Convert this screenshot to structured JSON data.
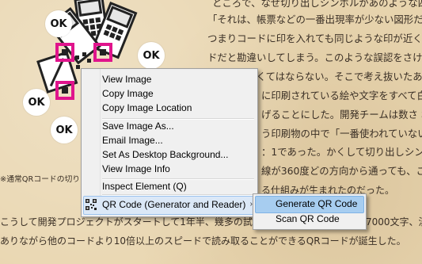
{
  "article": {
    "lines": [
      "ところで、なぜ切り出しシンボルがあのような四角",
      "「それは、帳票などの一番出現率が少ない図形だっ",
      "つまりコードに印を入れても同じような印が近くに",
      "ドだと勘違いしてしまう。このような誤認をさける",
      "の辺りとなくてはならない。そこで考え抜いたあげ",
      "に印刷されている絵や文字をすべて白黒",
      "げることにした。開発チームは数さ れ",
      "う印刷物の中で「一番使われていない比",
      "：1であった。かくして切り出しシンボ",
      "線が360度どの方向から通っても、この",
      "る仕組みが生まれたのだった。"
    ],
    "caption": "※通常QRコードの切り",
    "bottom_line_1": "こうして開発プロジェクトがスタートして1年半、幾多の試行",
    "bottom_line_1_tail": "7000文字、漢",
    "bottom_line_2": "ありながら他のコードより10倍以上のスピードで読み取ることができるQRコードが誕生した。"
  },
  "illustration": {
    "ok_labels": [
      "OK",
      "OK",
      "OK",
      "OK",
      "OK"
    ]
  },
  "context_menu": {
    "items": [
      {
        "label": "View Image"
      },
      {
        "label": "Copy Image"
      },
      {
        "label": "Copy Image Location"
      },
      {
        "label": "Save Image As..."
      },
      {
        "label": "Email Image..."
      },
      {
        "label": "Set As Desktop Background..."
      },
      {
        "label": "View Image Info"
      },
      {
        "label": "Inspect Element (Q)"
      },
      {
        "label": "QR Code (Generator and Reader)"
      }
    ],
    "submenu_arrow": "›",
    "icon": "qr-code-icon"
  },
  "submenu": {
    "items": [
      {
        "label": "Generate QR Code",
        "highlighted": true
      },
      {
        "label": "Scan QR Code",
        "highlighted": false
      }
    ]
  },
  "colors": {
    "page_bg": "#e9d6b0",
    "menu_bg": "#f0f0f0",
    "highlight": "#a7cdf0",
    "marker_pink": "#e0148c"
  }
}
